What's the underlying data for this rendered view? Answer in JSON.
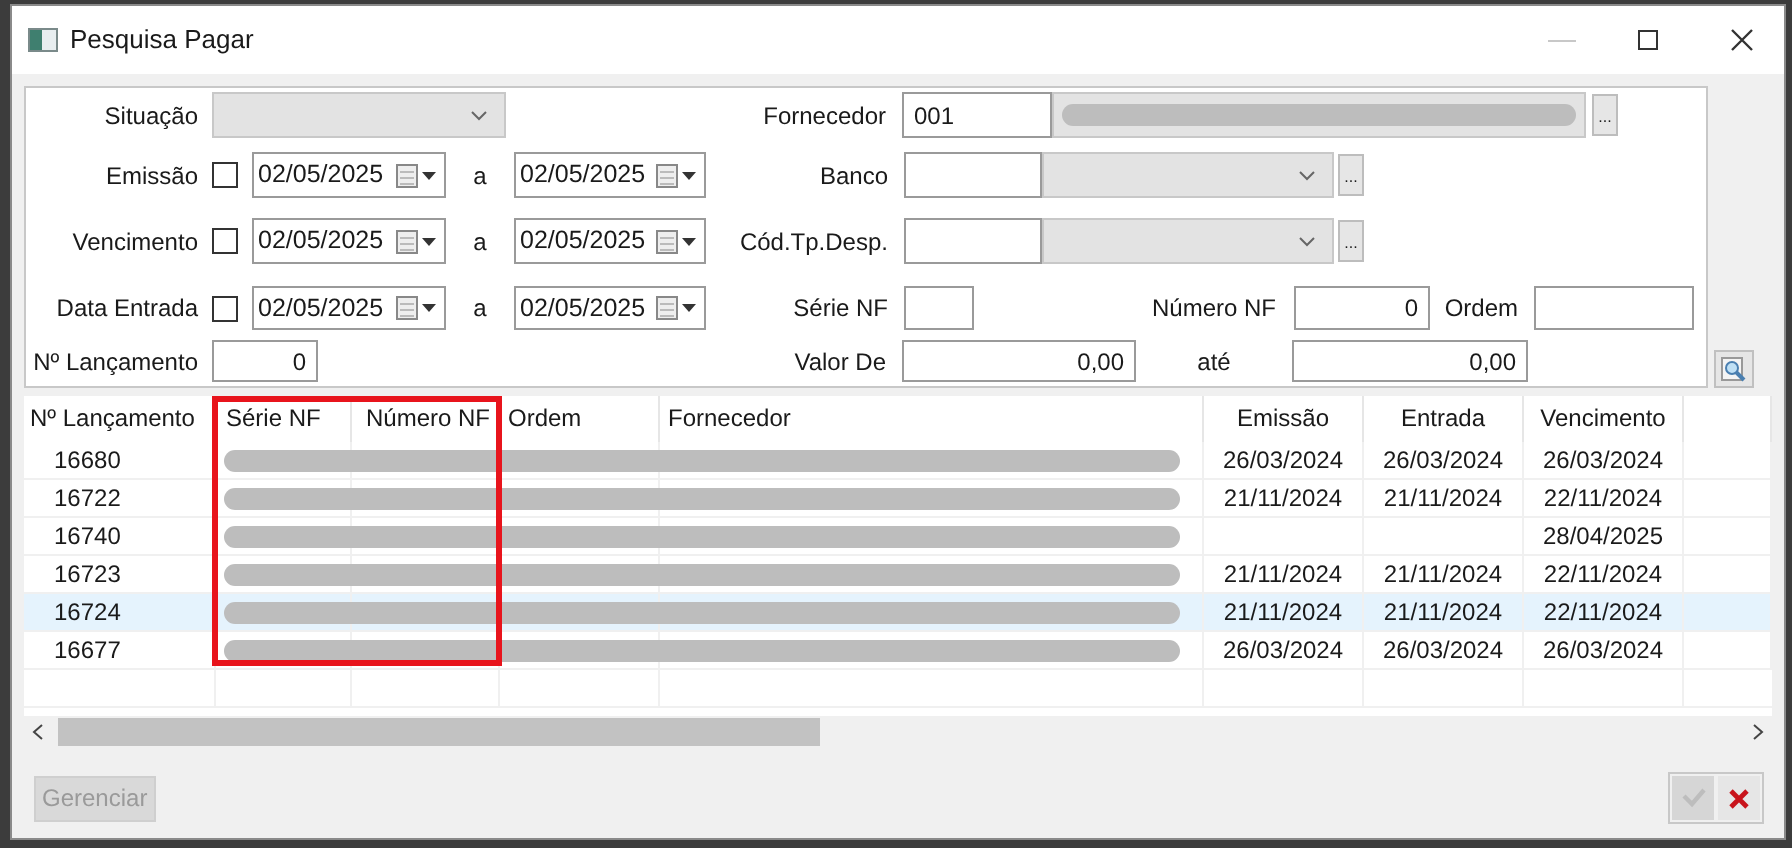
{
  "window": {
    "title": "Pesquisa Pagar"
  },
  "filters": {
    "situacao": {
      "label": "Situação",
      "disabled": true
    },
    "fornecedor": {
      "label": "Fornecedor",
      "code": "001",
      "button": "..."
    },
    "date_ranges": [
      {
        "label": "Emissão",
        "checked": false,
        "from": "02/05/2025",
        "sep": "a",
        "to": "02/05/2025"
      },
      {
        "label": "Vencimento",
        "checked": false,
        "from": "02/05/2025",
        "sep": "a",
        "to": "02/05/2025"
      },
      {
        "label": "Data Entrada",
        "checked": false,
        "from": "02/05/2025",
        "sep": "a",
        "to": "02/05/2025"
      }
    ],
    "lookups": [
      {
        "label": "Banco",
        "disabled": true,
        "button": "..."
      },
      {
        "label": "Cód.Tp.Desp.",
        "disabled": true,
        "button": "..."
      }
    ],
    "serie_nf": {
      "label": "Série NF"
    },
    "numero_nf": {
      "label": "Número NF",
      "value": "0"
    },
    "ordem": {
      "label": "Ordem"
    },
    "lancamento": {
      "label": "Nº Lançamento",
      "value": "0"
    },
    "valor_de": {
      "label": "Valor De",
      "value": "0,00"
    },
    "valor_ate": {
      "label": "até",
      "value": "0,00"
    }
  },
  "table": {
    "columns": [
      "Nº Lançamento",
      "Série NF",
      "Número NF",
      "Ordem",
      "Fornecedor",
      "Emissão",
      "Entrada",
      "Vencimento"
    ],
    "rows": [
      {
        "lancamento": "16680",
        "emissao": "26/03/2024",
        "entrada": "26/03/2024",
        "vencimento": "26/03/2024",
        "selected": false
      },
      {
        "lancamento": "16722",
        "emissao": "21/11/2024",
        "entrada": "21/11/2024",
        "vencimento": "22/11/2024",
        "selected": false
      },
      {
        "lancamento": "16740",
        "vencimento": "28/04/2025",
        "selected": false
      },
      {
        "lancamento": "16723",
        "emissao": "21/11/2024",
        "entrada": "21/11/2024",
        "vencimento": "22/11/2024",
        "selected": false
      },
      {
        "lancamento": "16724",
        "emissao": "21/11/2024",
        "entrada": "21/11/2024",
        "vencimento": "22/11/2024",
        "selected": true
      },
      {
        "lancamento": "16677",
        "emissao": "26/03/2024",
        "entrada": "26/03/2024",
        "vencimento": "26/03/2024",
        "selected": false
      }
    ]
  },
  "buttons": {
    "manage": {
      "label": "Gerenciar",
      "disabled": true
    },
    "confirm": {
      "disabled": true
    },
    "cancel": {
      "disabled": false
    }
  }
}
